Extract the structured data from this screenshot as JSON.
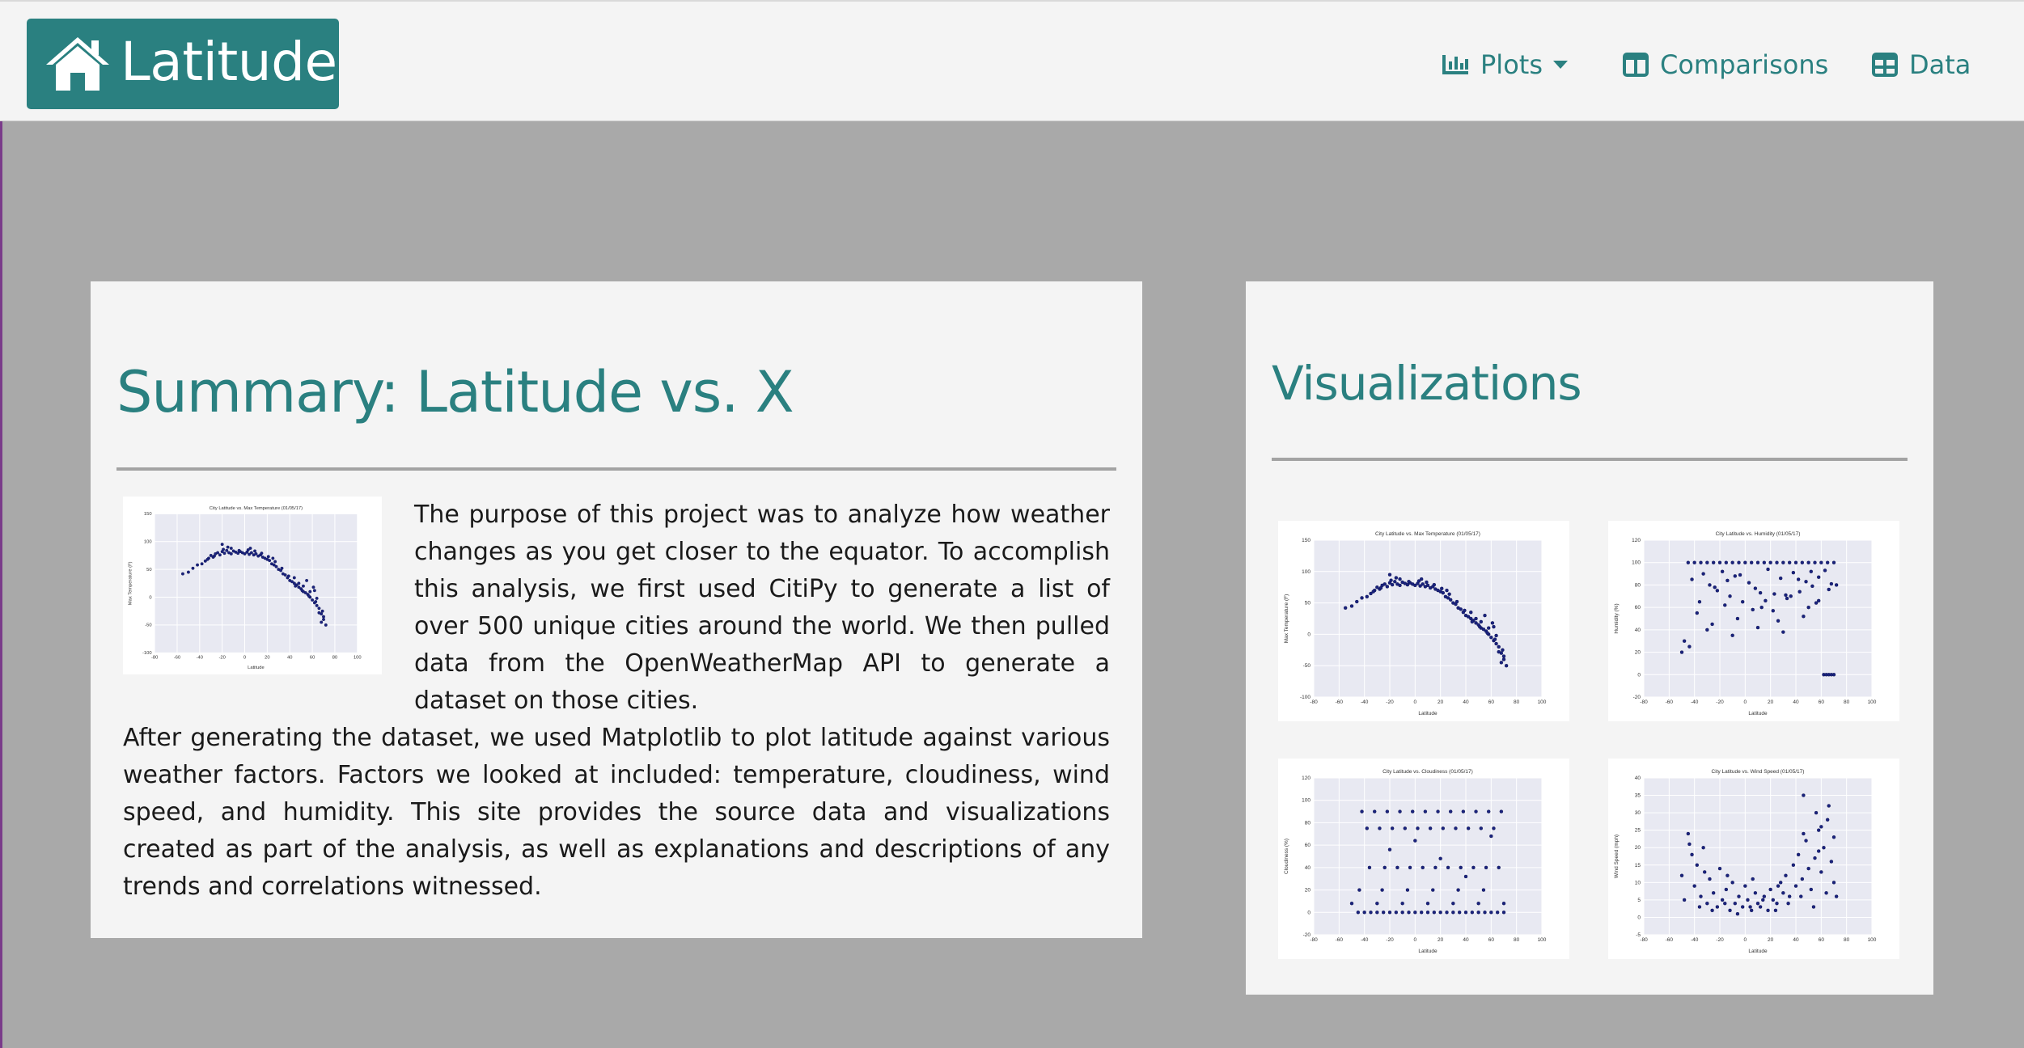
{
  "navbar": {
    "brand": "Latitude",
    "items": [
      {
        "label": "Plots",
        "has_dropdown": true,
        "icon": "bar-chart-icon"
      },
      {
        "label": "Comparisons",
        "icon": "columns-icon"
      },
      {
        "label": "Data",
        "icon": "table-icon"
      }
    ]
  },
  "summary": {
    "title": "Summary: Latitude vs. X",
    "paragraph1": "The purpose of this project was to analyze how weather changes as you get closer to the equator. To accomplish this analysis, we first used CitiPy to generate a list of over 500 unique cities around the world. We then pulled data from the OpenWeatherMap API to generate a dataset on those cities.",
    "paragraph2": "After generating the dataset, we used Matplotlib to plot latitude against various weather factors. Factors we looked at included: temperature, cloudiness, wind speed, and humidity. This site provides the source data and visualizations created as part of the analysis, as well as explanations and descriptions of any trends and correlations witnessed."
  },
  "visualizations": {
    "title": "Visualizations"
  },
  "colors": {
    "accent": "#2a8080",
    "panel": "#f4f4f4",
    "background": "#a9a9a9",
    "plot_bg": "#e8e9f2",
    "point": "#1a237e"
  },
  "chart_data": [
    {
      "type": "scatter",
      "title": "City Latitude vs. Max Temperature (01/05/17)",
      "xlabel": "Latitude",
      "ylabel": "Max Temperature (F)",
      "xlim": [
        -80,
        100
      ],
      "ylim": [
        -100,
        150
      ],
      "xticks": [
        -80,
        -60,
        -40,
        -20,
        0,
        20,
        40,
        60,
        80,
        100
      ],
      "yticks": [
        -100,
        -50,
        0,
        50,
        100,
        150
      ],
      "grid": true,
      "x": [
        -55,
        -50,
        -46,
        -42,
        -38,
        -35,
        -32,
        -30,
        -28,
        -26,
        -24,
        -22,
        -20,
        -18,
        -16,
        -14,
        -12,
        -10,
        -8,
        -6,
        -4,
        -2,
        0,
        2,
        4,
        6,
        8,
        10,
        12,
        14,
        16,
        18,
        20,
        22,
        24,
        26,
        28,
        30,
        32,
        34,
        36,
        38,
        40,
        42,
        44,
        46,
        48,
        50,
        52,
        54,
        56,
        58,
        60,
        62,
        64,
        66,
        68,
        70,
        72,
        -33,
        -27,
        -19,
        -12,
        -5,
        3,
        9,
        15,
        21,
        27,
        33,
        39,
        45,
        51,
        57,
        63,
        69,
        44,
        52,
        58,
        64,
        70,
        66,
        61,
        55,
        -20,
        -15,
        5,
        25,
        48,
        62,
        68
      ],
      "y": [
        42,
        45,
        52,
        58,
        60,
        65,
        70,
        75,
        72,
        78,
        80,
        76,
        82,
        79,
        84,
        80,
        78,
        83,
        81,
        79,
        82,
        80,
        78,
        81,
        77,
        80,
        76,
        78,
        74,
        76,
        72,
        70,
        68,
        66,
        60,
        58,
        55,
        50,
        48,
        42,
        40,
        35,
        30,
        28,
        25,
        22,
        18,
        15,
        10,
        8,
        5,
        0,
        -5,
        -10,
        -15,
        -20,
        -30,
        -40,
        -50,
        68,
        74,
        86,
        88,
        84,
        85,
        83,
        79,
        73,
        64,
        52,
        38,
        20,
        12,
        2,
        -8,
        -25,
        35,
        20,
        10,
        -2,
        -35,
        -28,
        18,
        30,
        95,
        90,
        88,
        70,
        25,
        12,
        -45
      ],
      "series_color": "#1a237e"
    },
    {
      "type": "scatter",
      "title": "City Latitude vs. Humidity (01/05/17)",
      "xlabel": "Latitude",
      "ylabel": "Humidity (%)",
      "xlim": [
        -80,
        100
      ],
      "ylim": [
        -20,
        120
      ],
      "xticks": [
        -80,
        -60,
        -40,
        -20,
        0,
        20,
        40,
        60,
        80,
        100
      ],
      "yticks": [
        -20,
        0,
        20,
        40,
        60,
        80,
        100,
        120
      ],
      "grid": true,
      "x": [
        -45,
        -40,
        -35,
        -30,
        -25,
        -20,
        -15,
        -10,
        -5,
        0,
        5,
        10,
        15,
        20,
        25,
        30,
        35,
        40,
        45,
        50,
        55,
        60,
        65,
        70,
        -42,
        -33,
        -28,
        -22,
        -18,
        -12,
        -8,
        -2,
        3,
        8,
        13,
        18,
        23,
        28,
        33,
        38,
        43,
        48,
        53,
        58,
        63,
        68,
        -38,
        -26,
        -16,
        -6,
        6,
        16,
        26,
        36,
        46,
        56,
        66,
        -48,
        -30,
        -10,
        10,
        30,
        50,
        62,
        64,
        66,
        68,
        70,
        -50,
        -44,
        -36,
        -24,
        -14,
        -4,
        12,
        22,
        32,
        42,
        52,
        58,
        72
      ],
      "y": [
        100,
        100,
        100,
        100,
        100,
        100,
        100,
        100,
        100,
        100,
        100,
        100,
        100,
        100,
        100,
        100,
        100,
        100,
        100,
        100,
        100,
        100,
        100,
        100,
        85,
        90,
        80,
        75,
        92,
        70,
        88,
        65,
        82,
        77,
        60,
        94,
        72,
        86,
        68,
        91,
        74,
        83,
        79,
        87,
        93,
        81,
        55,
        45,
        62,
        50,
        58,
        66,
        48,
        70,
        52,
        64,
        76,
        30,
        40,
        35,
        42,
        38,
        60,
        0,
        0,
        0,
        0,
        0,
        20,
        25,
        65,
        78,
        84,
        89,
        73,
        57,
        71,
        85,
        92,
        66,
        80
      ],
      "series_color": "#1a237e"
    },
    {
      "type": "scatter",
      "title": "City Latitude vs. Cloudiness (01/05/17)",
      "xlabel": "Latitude",
      "ylabel": "Cloudiness (%)",
      "xlim": [
        -80,
        100
      ],
      "ylim": [
        -20,
        120
      ],
      "xticks": [
        -80,
        -60,
        -40,
        -20,
        0,
        20,
        40,
        60,
        80,
        100
      ],
      "yticks": [
        -20,
        0,
        20,
        40,
        60,
        80,
        100,
        120
      ],
      "grid": true,
      "x": [
        -45,
        -40,
        -35,
        -30,
        -25,
        -20,
        -15,
        -10,
        -5,
        0,
        5,
        10,
        15,
        20,
        25,
        30,
        35,
        40,
        45,
        50,
        55,
        60,
        65,
        70,
        -38,
        -28,
        -18,
        -8,
        2,
        12,
        22,
        32,
        42,
        52,
        62,
        -42,
        -32,
        -22,
        -12,
        -2,
        8,
        18,
        28,
        38,
        48,
        58,
        68,
        -36,
        -24,
        -14,
        -4,
        6,
        16,
        26,
        36,
        46,
        56,
        66,
        -44,
        -26,
        -6,
        14,
        34,
        54,
        -50,
        -30,
        -10,
        10,
        30,
        50,
        70,
        -20,
        0,
        20,
        40,
        60
      ],
      "y": [
        0,
        0,
        0,
        0,
        0,
        0,
        0,
        0,
        0,
        0,
        0,
        0,
        0,
        0,
        0,
        0,
        0,
        0,
        0,
        0,
        0,
        0,
        0,
        0,
        75,
        75,
        75,
        75,
        75,
        75,
        75,
        75,
        75,
        75,
        75,
        90,
        90,
        90,
        90,
        90,
        90,
        90,
        90,
        90,
        90,
        90,
        90,
        40,
        40,
        40,
        40,
        40,
        40,
        40,
        40,
        40,
        40,
        40,
        20,
        20,
        20,
        20,
        20,
        20,
        8,
        8,
        8,
        8,
        8,
        8,
        8,
        56,
        64,
        48,
        32,
        68
      ],
      "series_color": "#1a237e"
    },
    {
      "type": "scatter",
      "title": "City Latitude vs. Wind Speed (01/05/17)",
      "xlabel": "Latitude",
      "ylabel": "Wind Speed (mph)",
      "xlim": [
        -80,
        100
      ],
      "ylim": [
        -5,
        40
      ],
      "xticks": [
        -80,
        -60,
        -40,
        -20,
        0,
        20,
        40,
        60,
        80,
        100
      ],
      "yticks": [
        -5,
        0,
        5,
        10,
        15,
        20,
        25,
        30,
        35,
        40
      ],
      "grid": true,
      "x": [
        -50,
        -45,
        -42,
        -40,
        -38,
        -35,
        -33,
        -30,
        -28,
        -25,
        -22,
        -20,
        -18,
        -15,
        -12,
        -10,
        -8,
        -5,
        -2,
        0,
        2,
        5,
        8,
        10,
        12,
        15,
        18,
        20,
        22,
        25,
        28,
        30,
        32,
        35,
        38,
        40,
        42,
        45,
        48,
        50,
        52,
        55,
        58,
        60,
        62,
        65,
        68,
        70,
        -48,
        -36,
        -26,
        -16,
        -6,
        4,
        14,
        24,
        34,
        44,
        54,
        64,
        46,
        56,
        66,
        60,
        70,
        -44,
        -32,
        -14,
        6,
        26,
        46,
        58,
        72
      ],
      "y": [
        12,
        24,
        18,
        9,
        15,
        6,
        20,
        4,
        11,
        7,
        3,
        14,
        5,
        8,
        2,
        10,
        4,
        6,
        3,
        9,
        5,
        2,
        7,
        4,
        3,
        6,
        2,
        8,
        5,
        4,
        10,
        7,
        12,
        6,
        15,
        9,
        18,
        11,
        22,
        14,
        8,
        17,
        25,
        13,
        20,
        28,
        16,
        10,
        5,
        3,
        2,
        4,
        1,
        3,
        5,
        2,
        4,
        6,
        3,
        7,
        35,
        30,
        32,
        26,
        23,
        21,
        13,
        12,
        11,
        9,
        24,
        19,
        6
      ],
      "series_color": "#1a237e"
    }
  ]
}
